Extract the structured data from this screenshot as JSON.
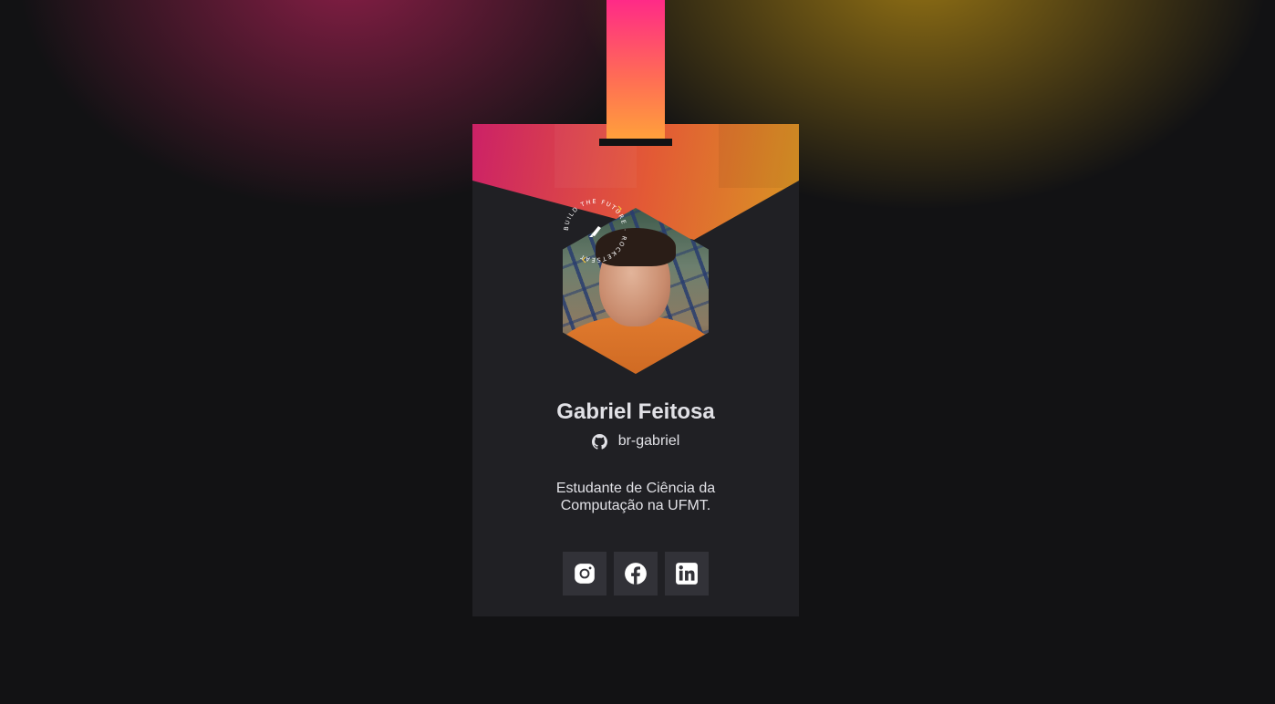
{
  "badge": {
    "name": "Gabriel Feitosa",
    "github": {
      "icon": "github-icon",
      "username": "br-gabriel"
    },
    "bio": "Estudante de Ciência da Computação na UFMT.",
    "seal_text": "BUILD THE FUTURE · ROCKETSEAT",
    "socials": [
      {
        "icon": "instagram-icon",
        "label": "Instagram"
      },
      {
        "icon": "facebook-icon",
        "label": "Facebook"
      },
      {
        "icon": "linkedin-icon",
        "label": "LinkedIn"
      }
    ]
  },
  "colors": {
    "background": "#121214",
    "card": "#202024",
    "button": "#323238",
    "text": "#e1e1e6",
    "accent_pink": "#ff2a87",
    "accent_orange": "#ffa33a",
    "accent_yellow": "#d7a020"
  }
}
